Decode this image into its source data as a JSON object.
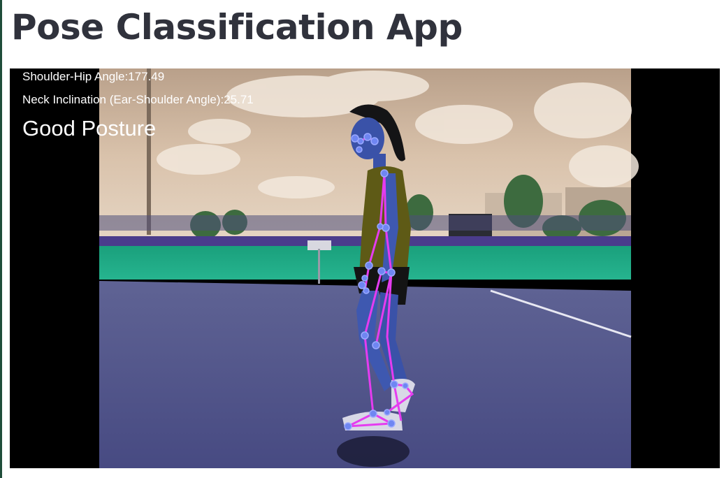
{
  "app": {
    "title": "Pose Classification App"
  },
  "video_frame": {
    "metrics": {
      "shoulder_hip_angle": "Shoulder-Hip Angle:177.49",
      "neck_inclination": "Neck Inclination (Ear-Shoulder Angle):25.71"
    },
    "posture_label": "Good Posture"
  },
  "colors": {
    "title_text": "#30323c",
    "skeleton_line": "#e53cf0",
    "landmark_point": "#6f86f2",
    "overlay_text": "#ffffff",
    "letterbox": "#000000"
  }
}
